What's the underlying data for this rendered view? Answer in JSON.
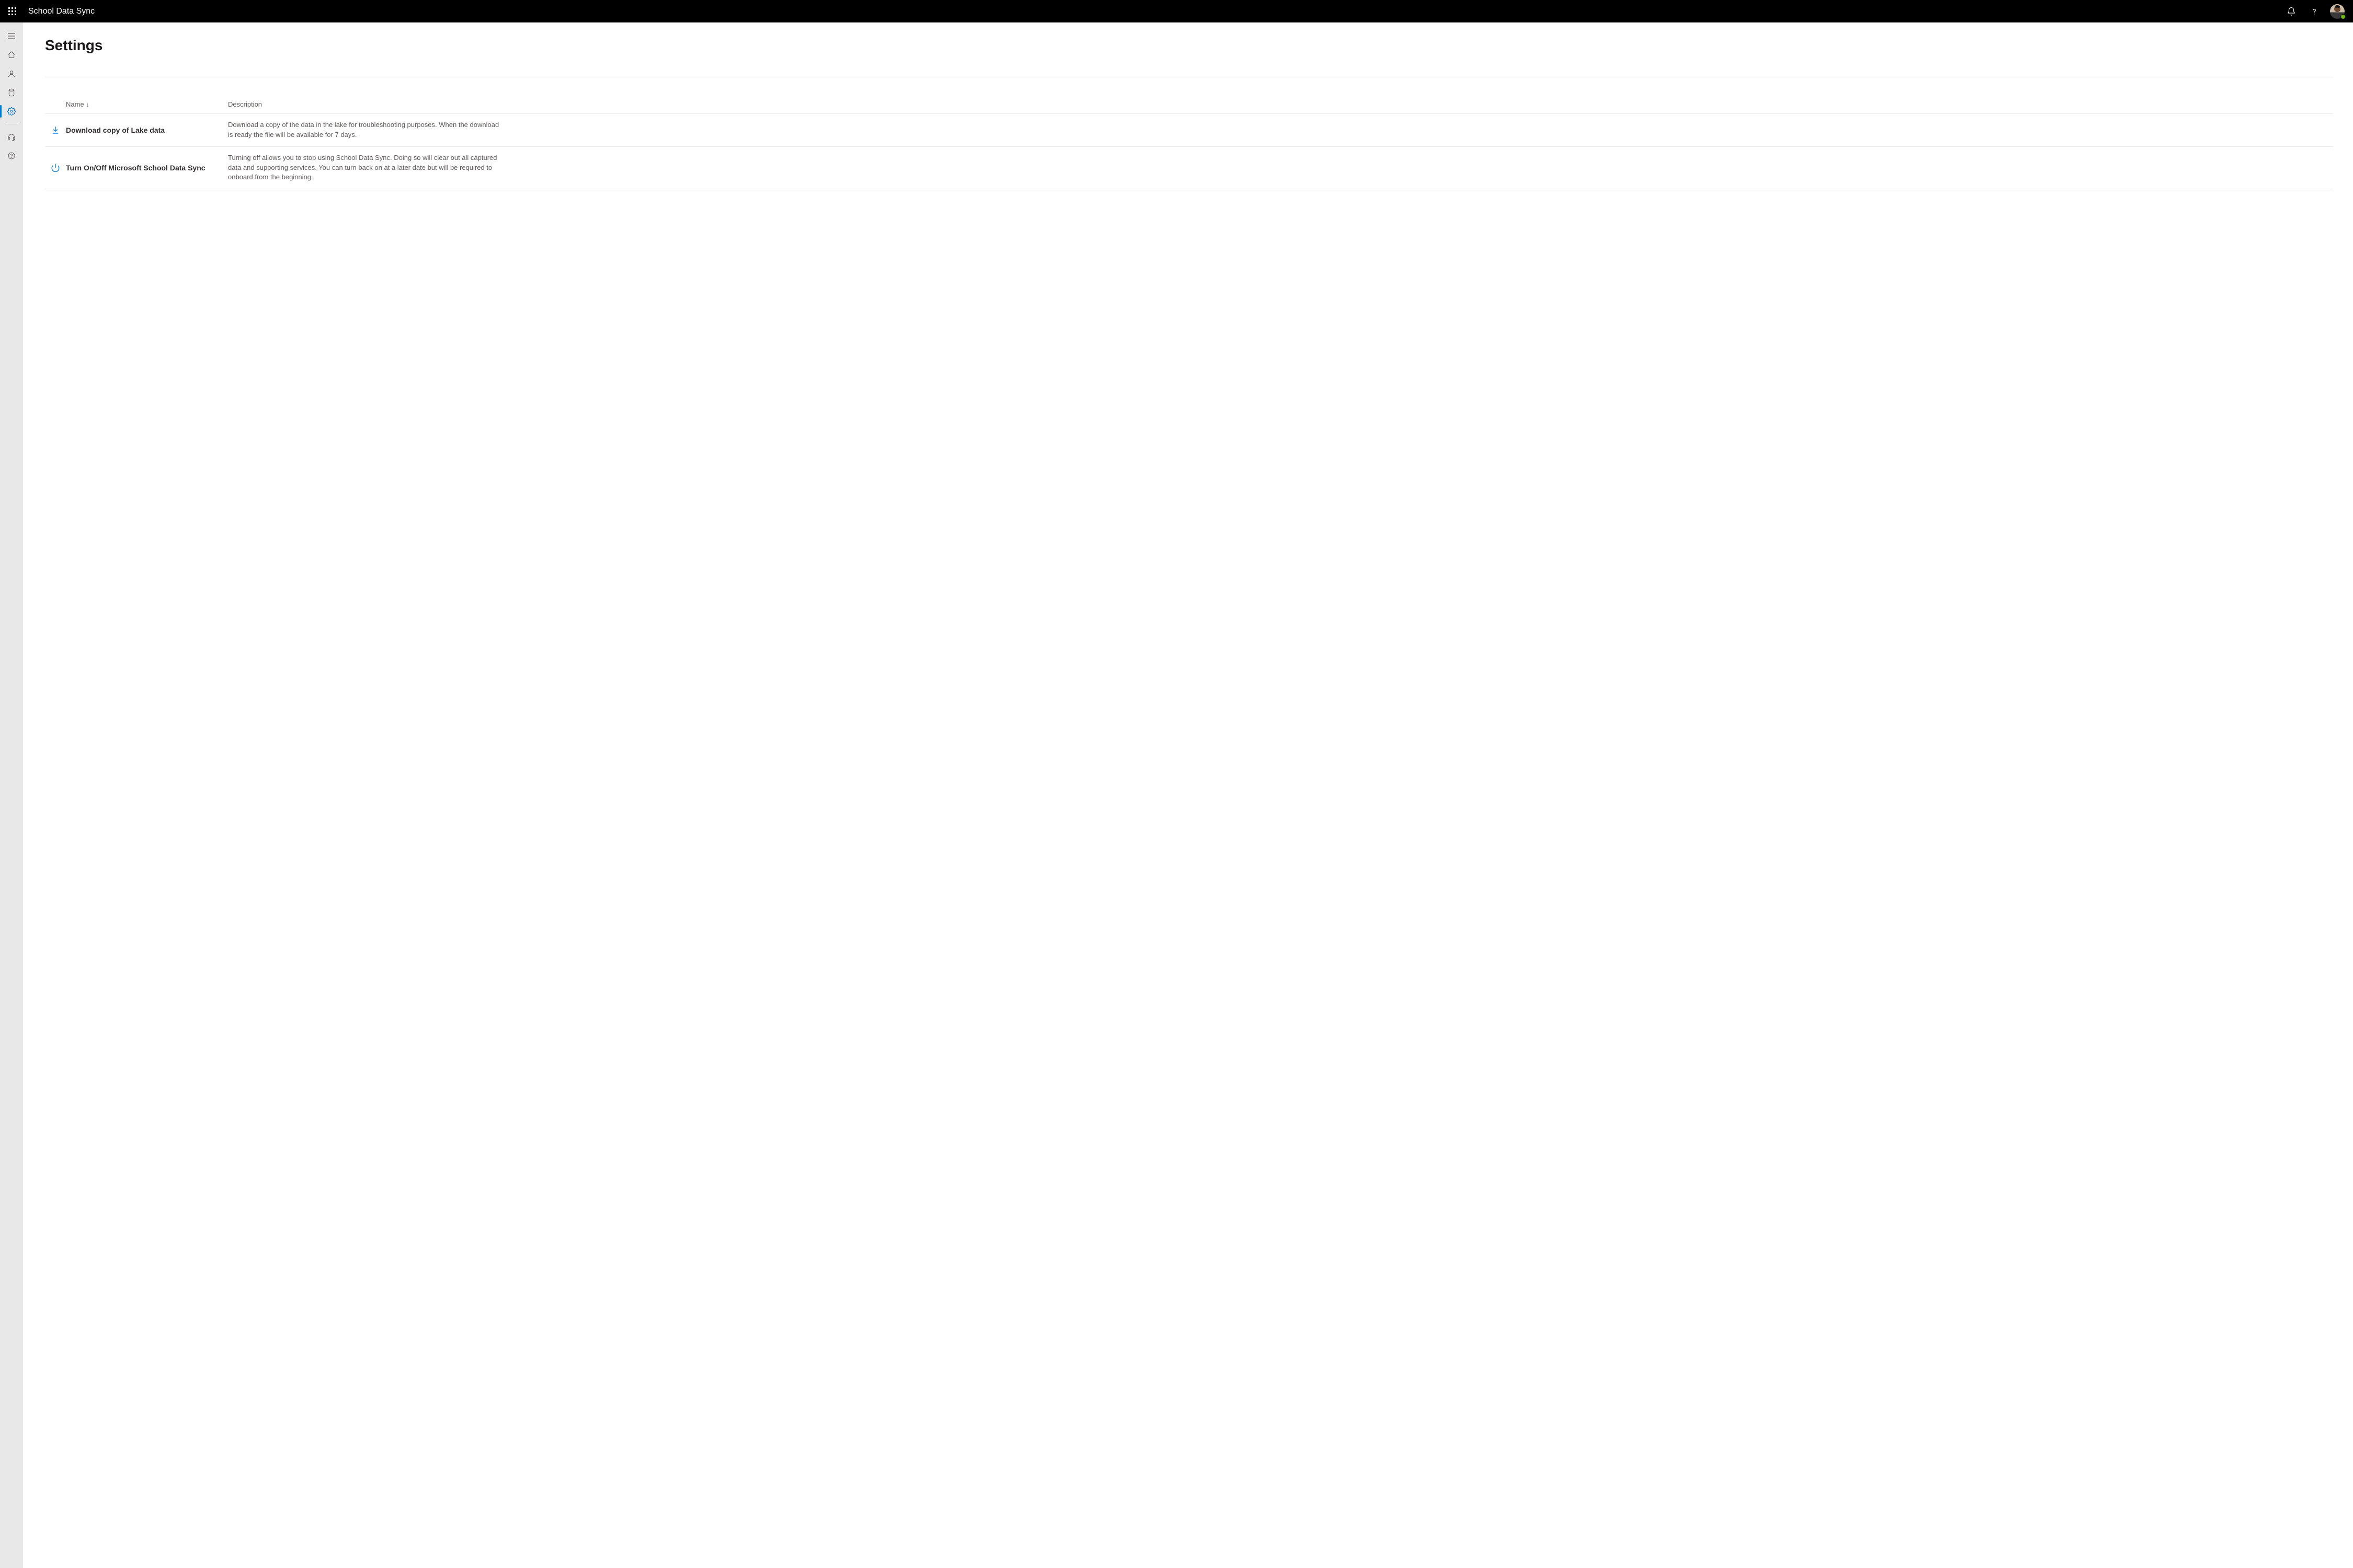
{
  "header": {
    "app_title": "School Data Sync"
  },
  "sidebar": {
    "items": [
      {
        "name": "menu",
        "active": false
      },
      {
        "name": "home",
        "active": false
      },
      {
        "name": "people",
        "active": false
      },
      {
        "name": "data",
        "active": false
      },
      {
        "name": "settings",
        "active": true
      },
      {
        "name": "support",
        "active": false
      },
      {
        "name": "help",
        "active": false
      }
    ]
  },
  "page": {
    "title": "Settings"
  },
  "table": {
    "columns": {
      "name": "Name",
      "description": "Description"
    },
    "sort_direction": "down",
    "rows": [
      {
        "icon": "download",
        "name": "Download copy of Lake data",
        "description": "Download a copy of the data in the lake for troubleshooting purposes. When the download is ready the file will be available for 7 days."
      },
      {
        "icon": "power",
        "name": "Turn On/Off Microsoft School Data Sync",
        "description": "Turning off allows you to stop using School Data Sync. Doing so will clear out all captured data and supporting services. You can turn back on at a later date but will be required to onboard from the beginning."
      }
    ]
  },
  "colors": {
    "accent": "#0078d4",
    "presence": "#6bb700"
  }
}
